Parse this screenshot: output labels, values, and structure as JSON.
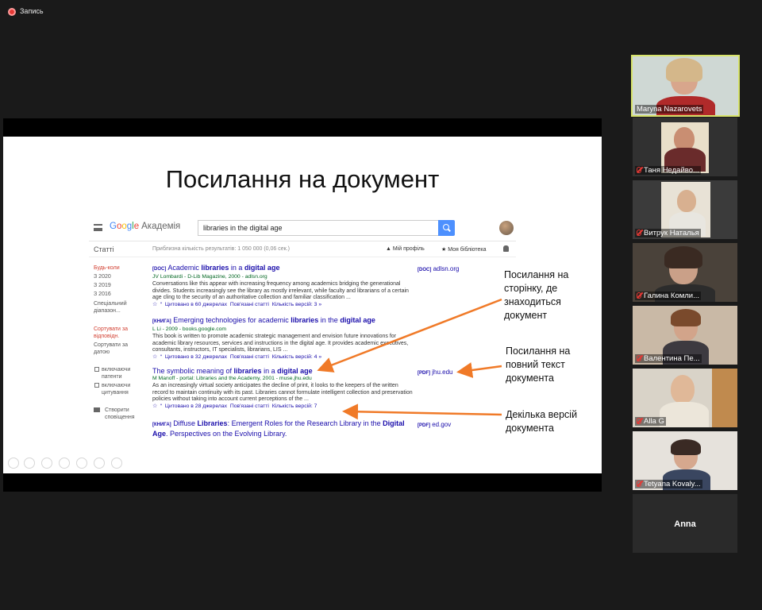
{
  "recording": {
    "label": "Запись"
  },
  "slide": {
    "title": "Посилання на документ"
  },
  "scholar": {
    "logo_google": [
      "G",
      "o",
      "o",
      "g",
      "l",
      "e"
    ],
    "logo_academy": "Академія",
    "query": "libraries in the digital age",
    "tab_articles": "Статті",
    "results_count": "Приблизна кількість результатів: 1 050 000 (0,06 сек.)",
    "my_profile": "Мій профіль",
    "my_library": "Моя бібліотека",
    "sidebar": {
      "any_time": "Будь-коли",
      "since_2020": "З 2020",
      "since_2019": "З 2019",
      "since_2016": "З 2016",
      "custom_range": "Спеціальний діапазон...",
      "sort_relevance": "Сортувати за відповідн.",
      "sort_date": "Сортувати за датою",
      "include_patents": "включаючи патенти",
      "include_citations": "включаючи цитування",
      "create_alert": "Створити сповіщення"
    },
    "results": [
      {
        "tag": "[DOC]",
        "title_pre": "Academic ",
        "title_b1": "libraries",
        "title_mid": " in a ",
        "title_b2": "digital age",
        "title_post": "",
        "authors": "JV Lombardi - D-Lib Magazine, 2000 - adlsn.org",
        "snippet": "Conversations like this appear with increasing frequency among academics bridging the generational divides. Students increasingly see the library as mostly irrelevant, while faculty and librarians of a certain age cling to the security of an authoritative collection and familiar classification ...",
        "cited": "Цитовано в 60 джерелах",
        "related": "Пов'язані статті",
        "versions": "Кількість версій: 3",
        "right_tag": "[DOC]",
        "right_link": "adlsn.org"
      },
      {
        "tag": "[КНИГА]",
        "title_pre": "Emerging technologies for academic ",
        "title_b1": "libraries",
        "title_mid": " in the ",
        "title_b2": "digital age",
        "title_post": "",
        "authors": "L Li - 2009 - books.google.com",
        "snippet": "This book is written to promote academic strategic management and envision future innovations for academic library resources, services and instructions in the digital age. It provides academic executives, consultants, instructors, IT specialists, librarians, LIS ...",
        "cited": "Цитовано в 32 джерелах",
        "related": "Пов'язані статті",
        "versions": "Кількість версій: 4",
        "right_tag": "",
        "right_link": ""
      },
      {
        "tag": "",
        "title_pre": "The symbolic meaning of ",
        "title_b1": "libraries",
        "title_mid": " in a ",
        "title_b2": "digital age",
        "title_post": "",
        "authors": "M Manoff - portal: Libraries and the Academy, 2001 - muse.jhu.edu",
        "snippet": "As an increasingly virtual society anticipates the decline of print, it looks to the keepers of the written record to maintain continuity with its past. Libraries cannot formulate intelligent collection and preservation policies without taking into account current perceptions of the ...",
        "cited": "Цитовано в 28 джерелах",
        "related": "Пов'язані статті",
        "versions": "Кількість версій: 7",
        "right_tag": "[PDF]",
        "right_link": "jhu.edu"
      },
      {
        "tag": "[КНИГА]",
        "title_pre": "Diffuse ",
        "title_b1": "Libraries",
        "title_mid": ": Emergent Roles for the Research Library in the ",
        "title_b2": "Digital Age",
        "title_post": ". Perspectives on the Evolving Library.",
        "right_tag": "[PDF]",
        "right_link": "ed.gov"
      }
    ]
  },
  "annotations": {
    "page_link": "Посилання на сторінку, де знаходиться документ",
    "fulltext_link": "Посилання на повний текст документа",
    "versions": "Декілька версій документа"
  },
  "participants": [
    {
      "name": "Maryna Nazarovets",
      "muted": false,
      "active": true
    },
    {
      "name": "Таня Недайво...",
      "muted": true
    },
    {
      "name": "Витрук Наталья",
      "muted": true
    },
    {
      "name": "Галина Комли...",
      "muted": true
    },
    {
      "name": "Валентина Пе...",
      "muted": true
    },
    {
      "name": "Alla G",
      "muted": true
    },
    {
      "name": "Tetyana Kovaly...",
      "muted": true
    },
    {
      "name": "Anna",
      "muted": false,
      "video": false
    }
  ],
  "colors": {
    "active_speaker_border": "#d7e36a",
    "annotation_arrow": "#f07a28",
    "link_blue": "#1a0dab"
  }
}
